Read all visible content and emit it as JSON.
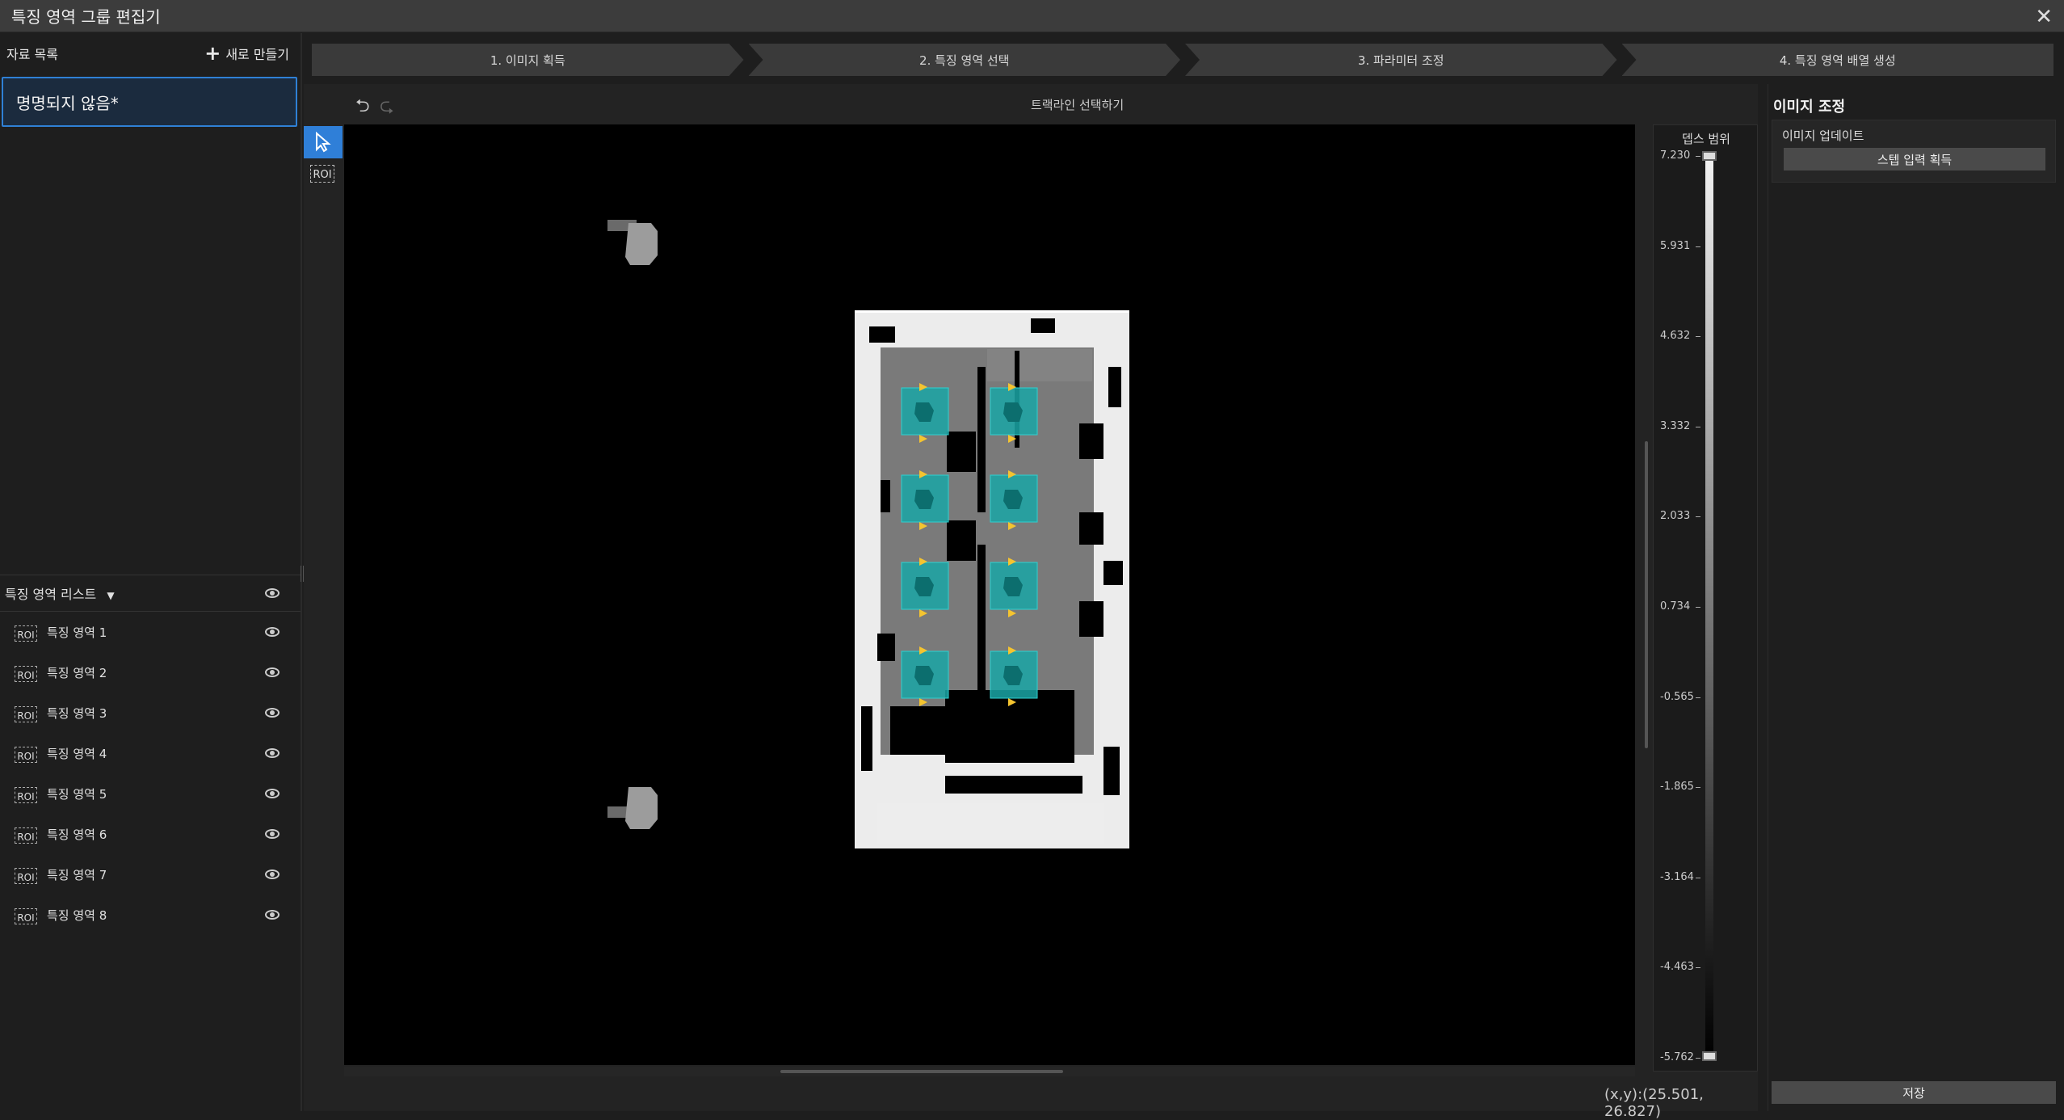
{
  "window": {
    "title": "특징 영역 그룹 편집기",
    "close": "✕"
  },
  "left": {
    "header": "자료 목록",
    "new_button": "새로 만들기",
    "selected_item": "명명되지 않음*",
    "roi_list_title": "특징 영역 리스트",
    "roi_items": [
      {
        "icon": "ROI",
        "label": "특징 영역 1"
      },
      {
        "icon": "ROI",
        "label": "특징 영역 2"
      },
      {
        "icon": "ROI",
        "label": "특징 영역 3"
      },
      {
        "icon": "ROI",
        "label": "특징 영역 4"
      },
      {
        "icon": "ROI",
        "label": "특징 영역 5"
      },
      {
        "icon": "ROI",
        "label": "특징 영역 6"
      },
      {
        "icon": "ROI",
        "label": "특징 영역 7"
      },
      {
        "icon": "ROI",
        "label": "특징 영역 8"
      }
    ]
  },
  "steps": [
    "1. 이미지 획득",
    "2. 특징 영역 선택",
    "3. 파라미터 조정",
    "4. 특징 영역 배열 생성"
  ],
  "center": {
    "undo": "⮌",
    "redo": "⮎",
    "tool_name": "트랙라인 선택하기",
    "roi_tool_label": "ROI",
    "coords": "(x,y):(25.501, 26.827)"
  },
  "depth": {
    "title": "뎁스 범위",
    "ticks": [
      "7.230",
      "5.931",
      "4.632",
      "3.332",
      "2.033",
      "0.734",
      "-0.565",
      "-1.865",
      "-3.164",
      "-4.463",
      "-5.762"
    ],
    "gradient_top": "#f2f2f2",
    "gradient_bottom": "#000000"
  },
  "right": {
    "title": "이미지 조정",
    "sub": "이미지 업데이트",
    "button": "스텝 입력 획득",
    "save": "저장"
  },
  "colors": {
    "accent": "#2f7fd8",
    "roi_fill": "#1aa6a6",
    "marker": "#f4c430"
  }
}
